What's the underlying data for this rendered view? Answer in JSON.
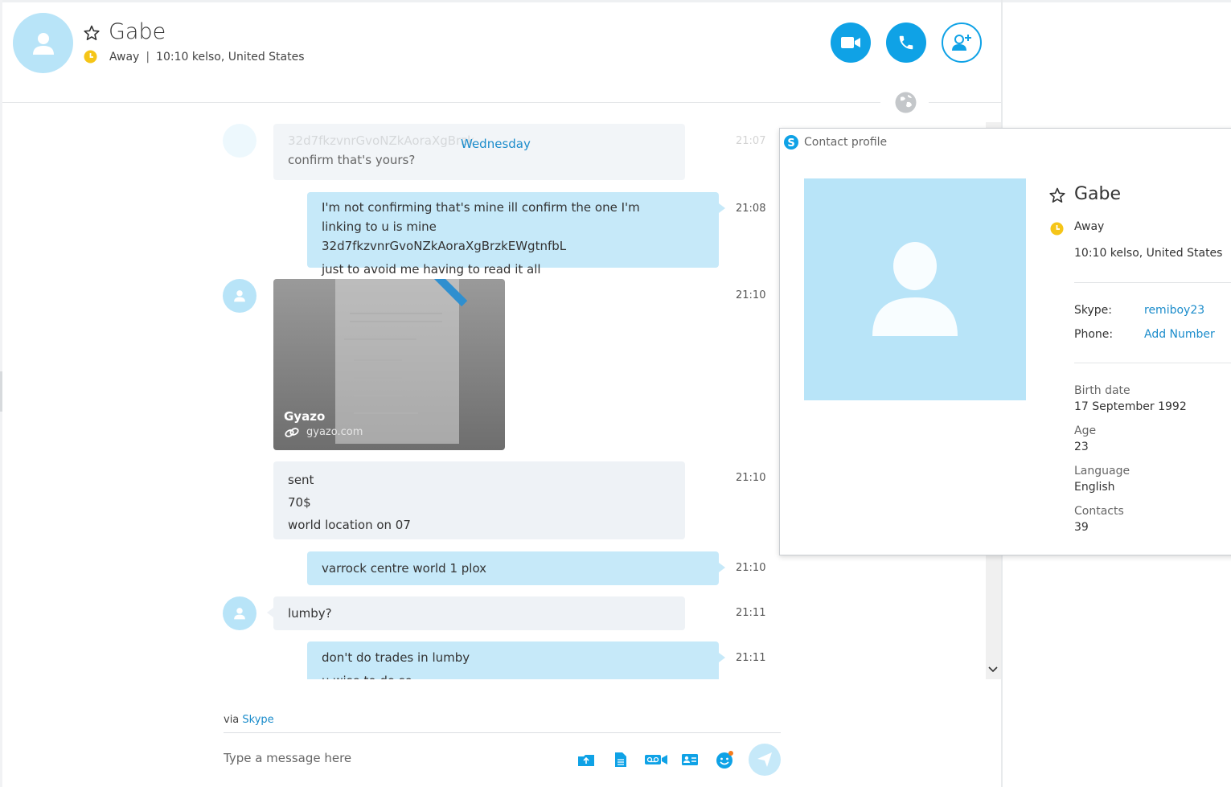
{
  "header": {
    "contact_name": "Gabe",
    "status": "Away",
    "separator": "|",
    "local_time_location": "10:10 kelso, United States"
  },
  "chat": {
    "day_separator": "Wednesday",
    "faded_message": {
      "line1": "32d7fkzvnrGvoNZkAoraXgBrzk",
      "line2": "confirm that's yours?",
      "time": "21:07"
    },
    "messages": [
      {
        "dir": "out",
        "time": "21:08",
        "lines": [
          "I'm not confirming that's mine ill confirm the one I'm linking to u is mine 32d7fkzvnrGvoNZkAoraXgBrzkEWgtnfbL",
          "just to avoid me having to read it all"
        ]
      },
      {
        "dir": "in",
        "time": "21:10",
        "card": {
          "title": "Gyazo",
          "domain": "gyazo.com"
        }
      },
      {
        "dir": "in",
        "time": "21:10",
        "lines": [
          "sent",
          "70$",
          "world location on 07"
        ]
      },
      {
        "dir": "out",
        "time": "21:10",
        "lines": [
          "varrock centre world 1 plox"
        ]
      },
      {
        "dir": "in",
        "time": "21:11",
        "lines": [
          "lumby?"
        ]
      },
      {
        "dir": "out",
        "time": "21:11",
        "lines": [
          "don't do trades in lumby",
          "u wise to do so"
        ]
      }
    ]
  },
  "composer": {
    "via_prefix": "via",
    "via_link": "Skype",
    "placeholder": "Type a message here"
  },
  "profile": {
    "title": "Contact profile",
    "name": "Gabe",
    "status": "Away",
    "location": "10:10 kelso, United States",
    "skype_label": "Skype:",
    "skype_value": "remiboy23",
    "phone_label": "Phone:",
    "phone_value": "Add Number",
    "birth_label": "Birth date",
    "birth_value": "17 September 1992",
    "age_label": "Age",
    "age_value": "23",
    "language_label": "Language",
    "language_value": "English",
    "contacts_label": "Contacts",
    "contacts_value": "39"
  },
  "colors": {
    "accent": "#0fa2e6",
    "away": "#f5c518",
    "link": "#1b8ccb",
    "bubble_out": "#c6e9f9",
    "bubble_in": "#eef2f6",
    "avatar": "#b8e4f8"
  },
  "icons": [
    "star-icon",
    "clock-icon",
    "video-icon",
    "phone-icon",
    "add-contact-icon",
    "globe-icon",
    "link-icon",
    "chevron-down-icon",
    "send-file-icon",
    "document-icon",
    "video-message-icon",
    "contact-card-icon",
    "emoticon-icon",
    "send-icon",
    "skype-icon",
    "person-icon"
  ]
}
